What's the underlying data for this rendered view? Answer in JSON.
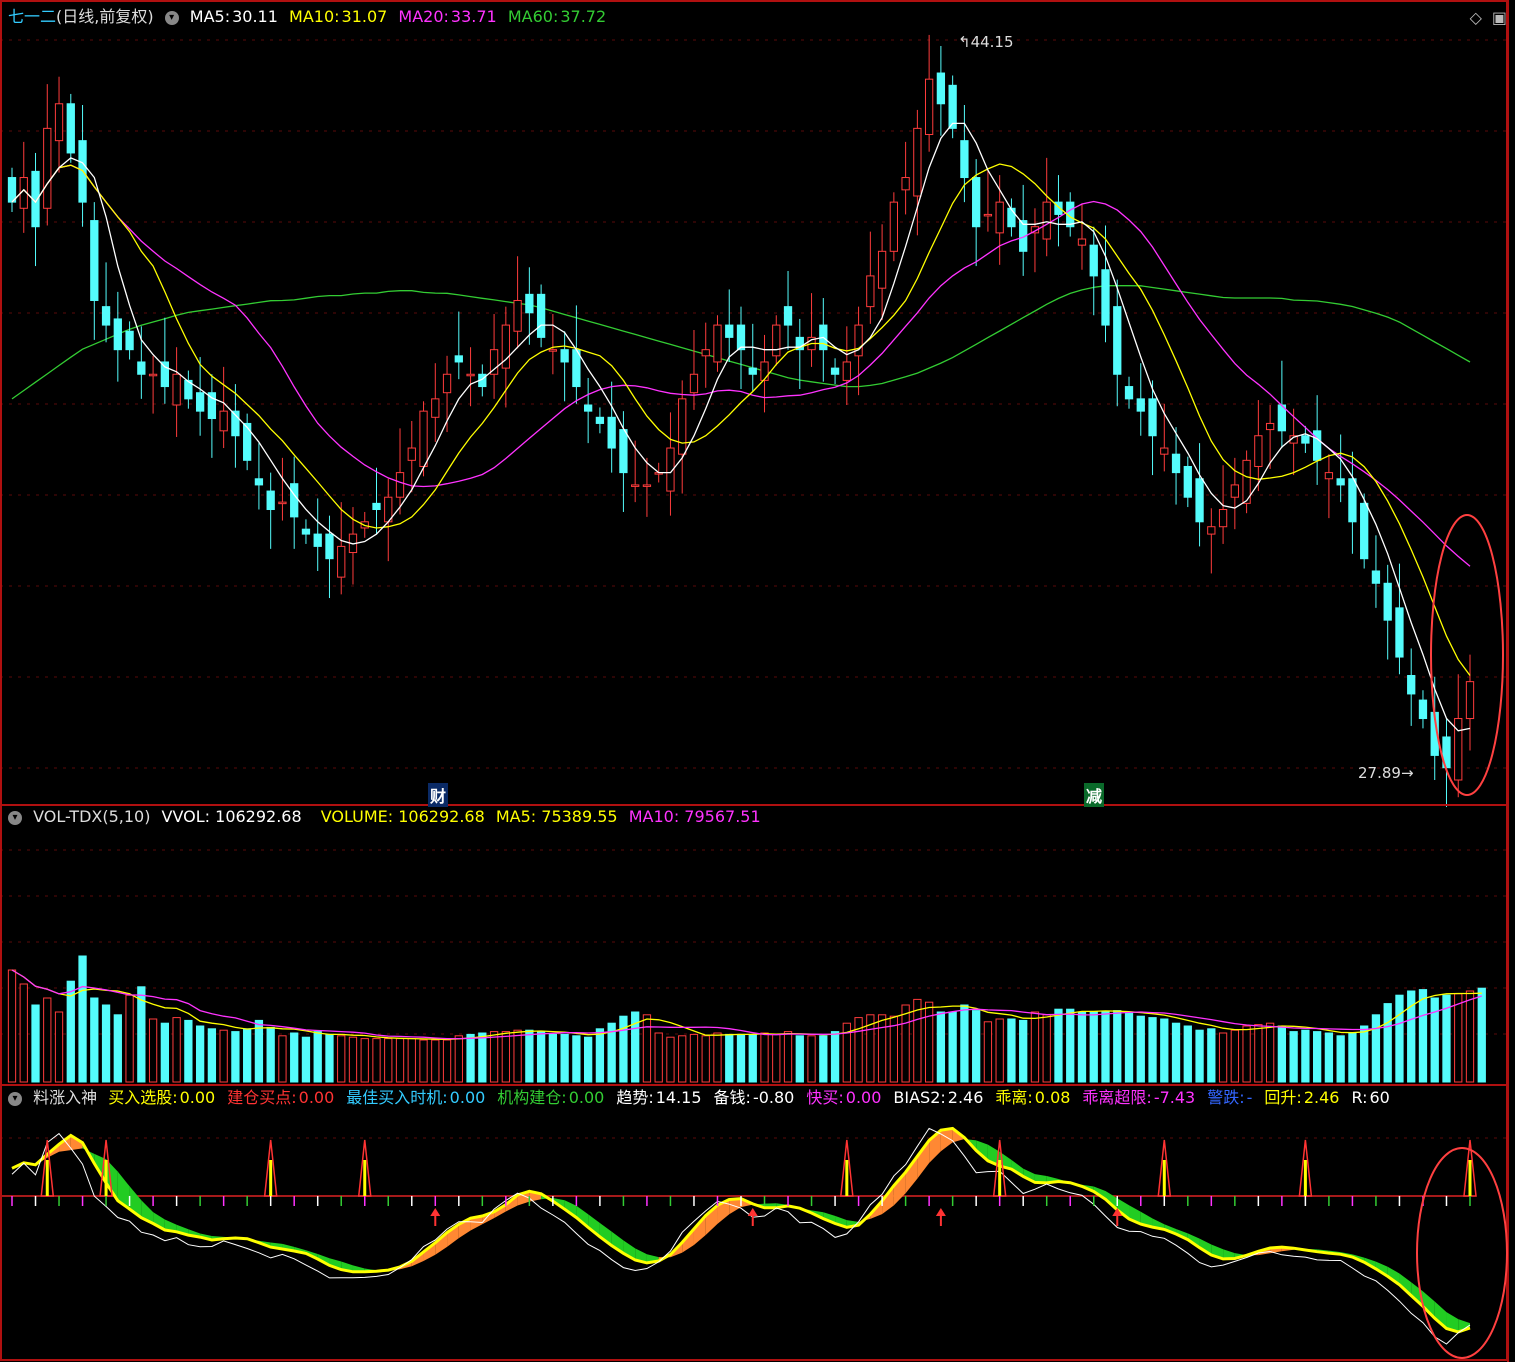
{
  "main_panel": {
    "title": "七一二",
    "mode": "(日线,前复权)",
    "ma5_label": "MA5:",
    "ma5_value": "30.11",
    "ma10_label": "MA10:",
    "ma10_value": "31.07",
    "ma20_label": "MA20:",
    "ma20_value": "33.71",
    "ma60_label": "MA60:",
    "ma60_value": "37.72",
    "high_label": "44.15",
    "low_label": "27.89",
    "marker_cai": "财",
    "marker_jian": "减"
  },
  "volume_panel": {
    "name": "VOL-TDX(5,10)",
    "vvol": "VVOL: 106292.68",
    "volume": "VOLUME: 106292.68",
    "ma5": "MA5: 75389.55",
    "ma10": "MA10: 79567.51"
  },
  "indicator_panel": {
    "name": "料涨入神",
    "items": [
      {
        "label": "买入选股:",
        "value": "0.00",
        "color": "#ffff00"
      },
      {
        "label": "建仓买点:",
        "value": "0.00",
        "color": "#ff3333"
      },
      {
        "label": "最佳买入时机:",
        "value": "0.00",
        "color": "#33ccff"
      },
      {
        "label": "机构建仓:",
        "value": "0.00",
        "color": "#33cc33"
      },
      {
        "label": "趋势:",
        "value": "14.15",
        "color": "#ffffff"
      },
      {
        "label": "备钱:",
        "value": "-0.80",
        "color": "#ffffff"
      },
      {
        "label": "快买:",
        "value": "0.00",
        "color": "#ff33ff"
      },
      {
        "label": "BIAS2:",
        "value": "2.46",
        "color": "#ffffff"
      },
      {
        "label": "乖离:",
        "value": "0.08",
        "color": "#ffff00"
      },
      {
        "label": "乖离超限:",
        "value": "-7.43",
        "color": "#ff33ff"
      },
      {
        "label": "警跌:",
        "value": "-",
        "color": "#3366ff"
      },
      {
        "label": "回升:",
        "value": "2.46",
        "color": "#ffff00"
      },
      {
        "label": "R:",
        "value": "60",
        "color": "#ffffff"
      }
    ]
  },
  "colors": {
    "up": "#ff3c3c",
    "down": "#54fcfc",
    "ma5": "#ffffff",
    "ma10": "#ffff00",
    "ma20": "#ff33ff",
    "ma60": "#33cc33",
    "border": "#b01010"
  },
  "chart_data": {
    "type": "candlestick",
    "closes": [
      38,
      39,
      37,
      41,
      42,
      40,
      38,
      34,
      33,
      32,
      32,
      31,
      31,
      30.5,
      31,
      30,
      29.5,
      29.2,
      29.5,
      28.5,
      27.5,
      26.5,
      25.5,
      25.8,
      25.2,
      24.5,
      24,
      23.5,
      24,
      24.5,
      25,
      25.5,
      26,
      27,
      28,
      29.5,
      30,
      31,
      31.5,
      31,
      30.5,
      32,
      33,
      34,
      33.5,
      32.5,
      32,
      31.5,
      30.5,
      29.5,
      29,
      28,
      27,
      26.5,
      26.5,
      27,
      28,
      30,
      31,
      32,
      33,
      32.5,
      32,
      31,
      31.5,
      33,
      33,
      32,
      32.5,
      32,
      31,
      31.5,
      33,
      35,
      36,
      38,
      39,
      41,
      43,
      42,
      41,
      39,
      37,
      37.5,
      38,
      37,
      36,
      37,
      38,
      37.5,
      37,
      36.5,
      35,
      33,
      31,
      30,
      29.5,
      28.5,
      28,
      27,
      26,
      25,
      24.8,
      25.5,
      26.5,
      27.5,
      28.5,
      29,
      28.7,
      28.5,
      28.2,
      27.5,
      27,
      26.5,
      25,
      23.5,
      22.5,
      21,
      19.5,
      18,
      17,
      15.5,
      15,
      17,
      18.5
    ],
    "price_range": [
      14.5,
      45
    ],
    "volume": [
      80,
      70,
      55,
      60,
      50,
      72,
      90,
      60,
      55,
      48,
      62,
      68,
      45,
      42,
      46,
      44,
      40,
      38,
      37,
      36,
      38,
      44,
      39,
      33,
      35,
      32,
      36,
      34,
      33,
      32,
      31,
      31,
      31,
      31,
      31,
      30,
      30,
      30,
      33,
      34,
      35,
      36,
      36,
      37,
      37,
      36,
      34,
      34,
      33,
      32,
      38,
      42,
      47,
      50,
      48,
      35,
      32,
      33,
      34,
      33,
      35,
      34,
      34,
      34,
      35,
      34,
      36,
      33,
      33,
      33,
      36,
      42,
      46,
      48,
      48,
      47,
      55,
      59,
      57,
      50,
      50,
      55,
      51,
      43,
      45,
      45,
      44,
      50,
      48,
      52,
      52,
      50,
      50,
      50,
      51,
      50,
      47,
      46,
      45,
      42,
      40,
      37,
      38,
      35,
      37,
      40,
      41,
      42,
      40,
      36,
      37,
      36,
      35,
      33,
      35,
      40,
      48,
      56,
      62,
      65,
      66,
      60,
      62,
      63,
      65,
      67
    ],
    "volume_range": [
      0,
      180
    ],
    "ma60": [
      30,
      30.5,
      31,
      31.5,
      32,
      32.3,
      32.6,
      32.9,
      33.1,
      33.3,
      33.5,
      33.6,
      33.7,
      33.8,
      33.9,
      34,
      34,
      34.1,
      34.2,
      34.2,
      34.3,
      34.3,
      34.4,
      34.4,
      34.3,
      34.3,
      34.2,
      34.1,
      34,
      33.9,
      33.8,
      33.6,
      33.4,
      33.2,
      33,
      32.8,
      32.6,
      32.4,
      32.2,
      32,
      31.8,
      31.6,
      31.4,
      31.2,
      31,
      30.8,
      30.7,
      30.6,
      30.5,
      30.5,
      30.6,
      30.8,
      31,
      31.3,
      31.6,
      32,
      32.4,
      32.8,
      33.2,
      33.6,
      34,
      34.3,
      34.5,
      34.6,
      34.6,
      34.6,
      34.5,
      34.4,
      34.3,
      34.2,
      34.1,
      34.1,
      34.1,
      34.1,
      34.0,
      34.0,
      33.9,
      33.8,
      33.6,
      33.4,
      33.1,
      32.7,
      32.3,
      31.9,
      31.5
    ]
  }
}
